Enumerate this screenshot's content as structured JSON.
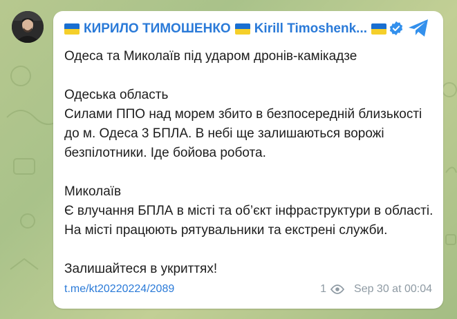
{
  "channel": {
    "name": "КИРИЛО ТИМОШЕНКО",
    "name_latin": "Kirill Timoshenk..."
  },
  "post": {
    "text": "Одеса та Миколаїв під ударом дронів-камікадзе\n\nОдеська область\nСилами ППО над морем збито в безпосередній близькості до м. Одеса 3 БПЛА. В небі ще залишаються ворожі безпілотники. Іде бойова робота.\n\nМиколаїв\nЄ влучання БПЛА в місті та об’єкт інфраструктури в області. На місті працюють рятувальники та екстрені служби.\n\nЗалишайтеся в укриттях!",
    "link": "t.me/kt20220224/2089",
    "views": "1",
    "timestamp": "Sep 30 at 00:04"
  },
  "icons": {
    "flag": "ukraine-flag-icon",
    "verified": "verified-badge-icon",
    "telegram": "telegram-logo-icon",
    "views": "eye-icon"
  },
  "colors": {
    "accent": "#2a7ad8",
    "meta": "#8e9aa3",
    "background": "#b7c88f",
    "card": "#ffffff"
  }
}
